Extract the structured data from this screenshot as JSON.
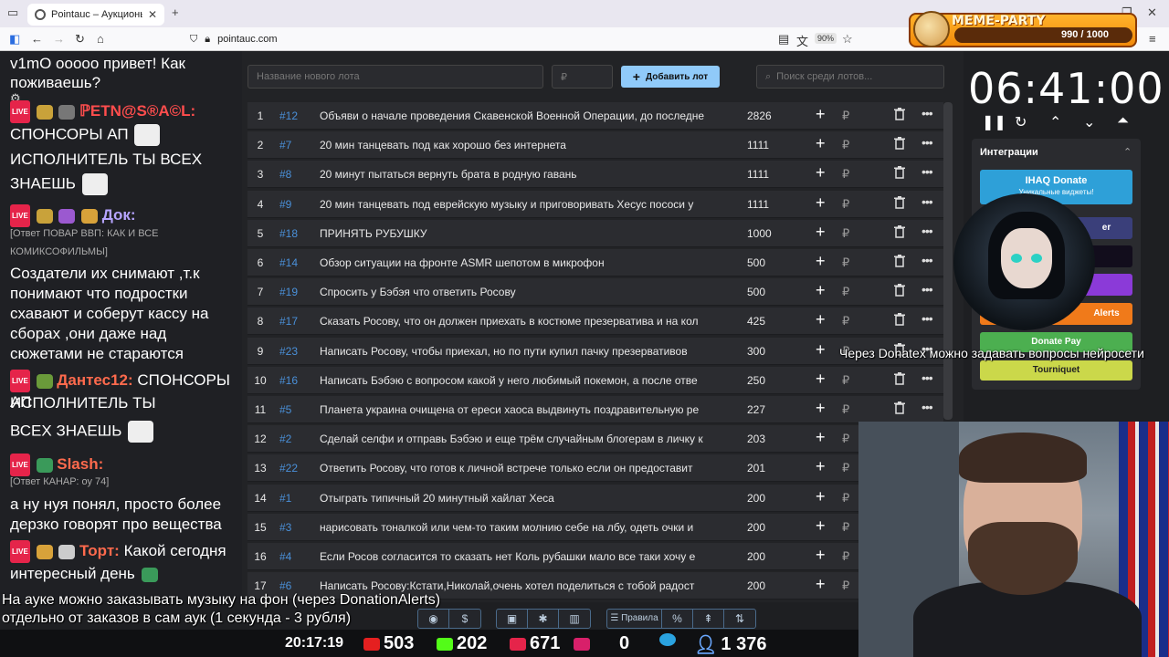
{
  "browser": {
    "tab_title": "Pointauc – Аукционы, лотере",
    "url": "pointauc.com",
    "zoom": "90%"
  },
  "meme_party": {
    "title": "MEME-PARTY",
    "value": "990 / 1000",
    "fill": 0.99
  },
  "chat": {
    "lines": [
      {
        "text": "v1mO ooooo привет! Как поживаешь?"
      },
      {
        "nick": "ℙETN@S®A©L:",
        "nick_color": "#ff4d4d"
      },
      {
        "text": "СПОНСОРЫ АП"
      },
      {
        "text": "ИСПОЛНИТЕЛЬ ТЫ ВСЕХ"
      },
      {
        "text": "ЗНАЕШЬ"
      },
      {
        "nick": "Док:",
        "nick_color": "#b6a4ff"
      },
      {
        "reply": "[Ответ ПОВАР ВВП: КАК И ВСЕ"
      },
      {
        "reply": "КОМИКСОФИЛЬМЫ]"
      },
      {
        "text": "Создатели их снимают ,т.к понимают что подростки схавают и соберут кассу на сборах ,они даже над сюжетами не стараются"
      },
      {
        "nick": "Дантес12:",
        "nick_color": "#ff6a4d",
        "text": "СПОНСОРЫ АП"
      },
      {
        "text": "ИСПОЛНИТЕЛЬ ТЫ"
      },
      {
        "text": "ВСЕХ ЗНАЕШЬ"
      },
      {
        "nick": "Slash:",
        "nick_color": "#ff6a4d"
      },
      {
        "reply": "[Ответ КАНАР: оу 74]"
      },
      {
        "text": "а ну нуя понял, просто более дерзко говорят про вещества"
      },
      {
        "nick": "Торт:",
        "nick_color": "#ff6a4d",
        "text": "Какой сегодня"
      },
      {
        "text": "интересный день"
      }
    ]
  },
  "controls": {
    "new_lot_placeholder": "Название нового лота",
    "amount_placeholder": "₽",
    "add_button": "Добавить лот",
    "search_placeholder": "Поиск среди лотов..."
  },
  "lots": [
    {
      "n": "1",
      "id": "#12",
      "title": "Объяви о начале проведения Скавенской Военной Операции, до последне",
      "amount": "2826"
    },
    {
      "n": "2",
      "id": "#7",
      "title": "20 мин танцевать под как хорошо без интернета",
      "amount": "1111"
    },
    {
      "n": "3",
      "id": "#8",
      "title": "20 минут пытаться вернуть брата в родную гавань",
      "amount": "1111"
    },
    {
      "n": "4",
      "id": "#9",
      "title": "20 мин танцевать под еврейскую музыку и приговоривать Хесус пососи у",
      "amount": "1111"
    },
    {
      "n": "5",
      "id": "#18",
      "title": "ПРИНЯТЬ РУБУШКУ",
      "amount": "1000"
    },
    {
      "n": "6",
      "id": "#14",
      "title": "Обзор ситуации на фронте ASMR шепотом в микрофон",
      "amount": "500"
    },
    {
      "n": "7",
      "id": "#19",
      "title": "Спросить у Бэбэя что ответить Росову",
      "amount": "500"
    },
    {
      "n": "8",
      "id": "#17",
      "title": "Сказать Росову, что он должен приехать в костюме презерватива и на кол",
      "amount": "425"
    },
    {
      "n": "9",
      "id": "#23",
      "title": "Написать Росову, чтобы приехал, но по пути купил пачку презервативов",
      "amount": "300"
    },
    {
      "n": "10",
      "id": "#16",
      "title": "Написать Бэбэю с вопросом какой у него любимый покемон, а после отве",
      "amount": "250"
    },
    {
      "n": "11",
      "id": "#5",
      "title": "Планета украина очищена от ереси хаоса выдвинуть поздравительную ре",
      "amount": "227"
    },
    {
      "n": "12",
      "id": "#2",
      "title": "Сделай селфи и отправь Бэбэю и еще трём случайным блогерам в личку к",
      "amount": "203"
    },
    {
      "n": "13",
      "id": "#22",
      "title": "Ответить Росову, что готов к личной встрече только если он предоставит",
      "amount": "201"
    },
    {
      "n": "14",
      "id": "#1",
      "title": "Отыграть типичный 20 минутный хайлат Хеса",
      "amount": "200"
    },
    {
      "n": "15",
      "id": "#3",
      "title": "нарисовать тоналкой или чем-то таким молнию себе на лбу, одеть очки и",
      "amount": "200"
    },
    {
      "n": "16",
      "id": "#4",
      "title": "Если Росов согласится то сказать нет Коль рубашки мало все таки хочу е",
      "amount": "200"
    },
    {
      "n": "17",
      "id": "#6",
      "title": "Написать Росову:Кстати,Николай,очень хотел поделиться с тобой радост",
      "amount": "200"
    }
  ],
  "timer": {
    "value": "06:41:00"
  },
  "integrations": {
    "title": "Интеграции",
    "ihaq": {
      "label": "IHAQ Donate",
      "sub": "Уникальные виджеты!"
    },
    "er_label": "er",
    "alerts_label": "Alerts",
    "donatepay_label": "Donate Pay",
    "tourniquet_label": "Tourniquet"
  },
  "overlays": {
    "donatex": "Через Donatex можно задавать вопросы нейросети",
    "sub1": "На ауке можно заказывать музыку на фон (через DonationAlerts)",
    "sub2": "отдельно от заказов в сам аук (1 секунда - 3 рубля)"
  },
  "toolbar": {
    "rules_label": "Правила"
  },
  "stats": {
    "clock": "20:17:19",
    "youtube": "503",
    "kick": "202",
    "live": "671",
    "other": "0",
    "viewers": "1 376"
  }
}
